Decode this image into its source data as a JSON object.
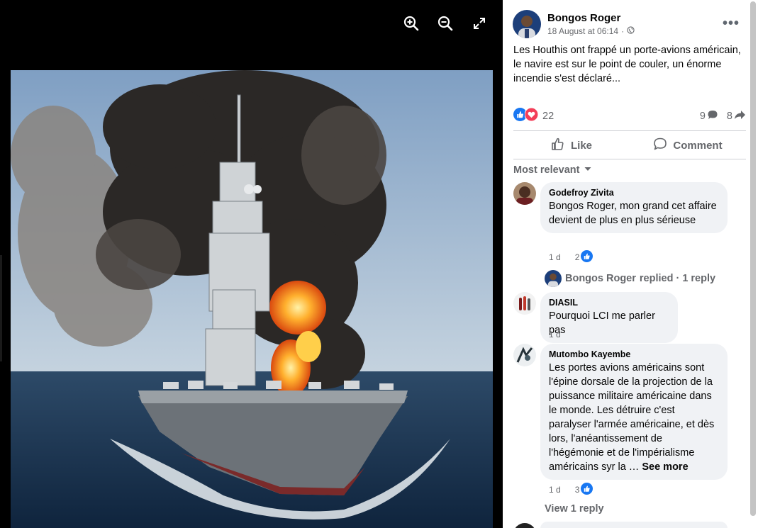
{
  "viewer": {
    "tools": [
      {
        "icon": "zoom-in-icon"
      },
      {
        "icon": "zoom-out-icon"
      },
      {
        "icon": "fullscreen-icon"
      }
    ]
  },
  "post": {
    "author": "Bongos Roger",
    "timestamp": "18 August at 06:14",
    "separator": "·",
    "audience_icon": "globe-icon",
    "more_label": "•••",
    "text": "Les Houthis ont frappé un porte-avions américain, le navire est sur le point de couler, un énorme incendie s'est déclaré...",
    "reaction_count": "22",
    "comment_count": "9",
    "share_count": "8",
    "like_label": "Like",
    "comment_label": "Comment",
    "sort_label": "Most relevant"
  },
  "comments": [
    {
      "name": "Godefroy Zivita",
      "text": "Bongos Roger, mon grand cet affaire devient de plus en plus sérieuse",
      "age": "1 d",
      "likes": "2"
    },
    {
      "name": "DIASIL",
      "text": "Pourquoi LCI me parler pas",
      "age": "1 d"
    },
    {
      "name": "Mutombo Kayembe",
      "text": "Les portes avions américains sont l'épine dorsale de la projection de la puissance militaire américaine dans le monde. Les détruire c'est paralyser l'armée américaine, et dès lors, l'anéantissement de l'hégémonie et de l'impérialisme américains syr la …",
      "see_more": "See more",
      "age": "1 d",
      "likes": "3"
    }
  ],
  "reply_summary": {
    "name": "Bongos Roger",
    "suffix": "replied · 1 reply"
  },
  "view_reply_label": "View 1 reply",
  "colors": {
    "like_blue": "#1877f2",
    "love_red": "#f33e58",
    "muted": "#65676b"
  }
}
